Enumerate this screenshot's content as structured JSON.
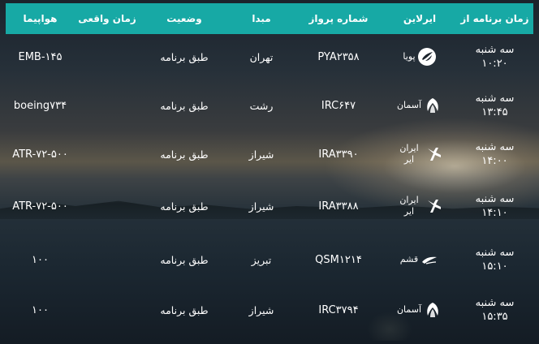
{
  "headers": {
    "scheduled": "زمان برنامه از",
    "airline": "ایرلاین",
    "flight": "شماره پرواز",
    "origin": "مبدا",
    "status": "وضعیت",
    "actual": "زمان واقعی",
    "aircraft": "هواپیما"
  },
  "colors": {
    "header_bg": "#17a9a5",
    "text": "#ffffff"
  },
  "flights": [
    {
      "day": "سه شنبه",
      "time": "۱۰:۲۰",
      "airline": "پویا",
      "airline_icon": "pouya-logo-icon",
      "flight": "PYA۲۳۵۸",
      "origin": "تهران",
      "status": "طبق برنامه",
      "actual": "",
      "aircraft": "EMB-۱۴۵"
    },
    {
      "day": "سه شنبه",
      "time": "۱۳:۴۵",
      "airline": "آسمان",
      "airline_icon": "aseman-logo-icon",
      "flight": "IRC۶۴۷",
      "origin": "رشت",
      "status": "طبق برنامه",
      "actual": "",
      "aircraft": "boeing۷۳۴"
    },
    {
      "day": "سه شنبه",
      "time": "۱۴:۰۰",
      "airline": "ایران ایر",
      "airline_icon": "iranair-logo-icon",
      "flight": "IRA۳۳۹۰",
      "origin": "شیراز",
      "status": "طبق برنامه",
      "actual": "",
      "aircraft": "ATR-۷۲-۵۰۰"
    },
    {
      "day": "سه شنبه",
      "time": "۱۴:۱۰",
      "airline": "ایران ایر",
      "airline_icon": "iranair-logo-icon",
      "flight": "IRA۳۳۸۸",
      "origin": "شیراز",
      "status": "طبق برنامه",
      "actual": "",
      "aircraft": "ATR-۷۲-۵۰۰"
    },
    {
      "day": "سه شنبه",
      "time": "۱۵:۱۰",
      "airline": "قشم",
      "airline_icon": "qeshm-logo-icon",
      "flight": "QSM۱۲۱۴",
      "origin": "تبریز",
      "status": "طبق برنامه",
      "actual": "",
      "aircraft": "۱۰۰"
    },
    {
      "day": "سه شنبه",
      "time": "۱۵:۳۵",
      "airline": "آسمان",
      "airline_icon": "aseman-logo-icon",
      "flight": "IRC۳۷۹۴",
      "origin": "شیراز",
      "status": "طبق برنامه",
      "actual": "",
      "aircraft": "۱۰۰"
    }
  ]
}
